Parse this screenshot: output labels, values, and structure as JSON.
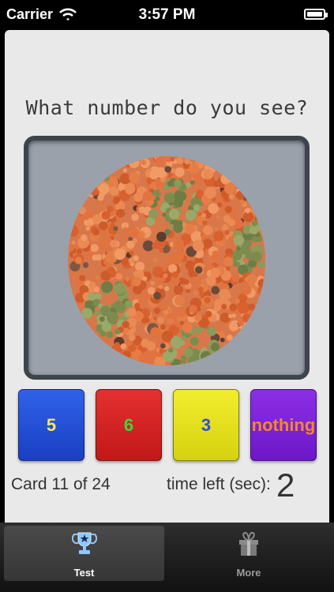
{
  "status_bar": {
    "carrier": "Carrier",
    "time": "3:57 PM"
  },
  "main": {
    "question": "What number do you see?",
    "answers": [
      "5",
      "6",
      "3",
      "nothing"
    ],
    "card_counter": "Card 11 of 24",
    "time_left_label": "time left (sec):",
    "time_left_value": "2"
  },
  "tab_bar": {
    "tabs": [
      {
        "label": "Test",
        "icon": "trophy-icon",
        "selected": true
      },
      {
        "label": "More",
        "icon": "gift-icon",
        "selected": false
      }
    ]
  },
  "colors": {
    "plate_orange": "#e0733f",
    "plate_green": "#8a9a5a",
    "plate_brown": "#6a4a3a"
  }
}
